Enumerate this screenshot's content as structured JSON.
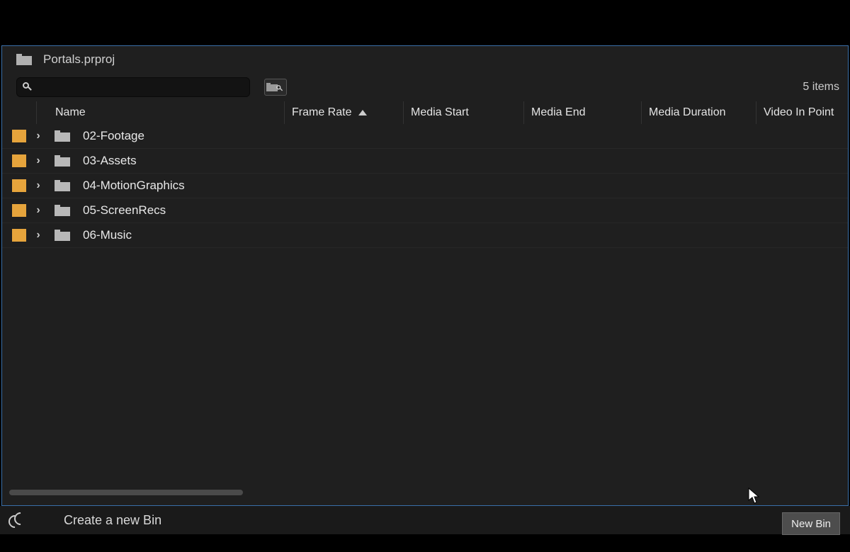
{
  "header": {
    "project_name": "Portals.prproj"
  },
  "search": {
    "placeholder": "",
    "item_count_label": "5 items"
  },
  "columns": {
    "name": "Name",
    "frame_rate": "Frame Rate",
    "media_start": "Media Start",
    "media_end": "Media End",
    "media_duration": "Media Duration",
    "video_in_point": "Video In Point"
  },
  "bins": [
    {
      "name": "02-Footage"
    },
    {
      "name": "03-Assets"
    },
    {
      "name": "04-MotionGraphics"
    },
    {
      "name": "05-ScreenRecs"
    },
    {
      "name": "06-Music"
    }
  ],
  "tutorial": {
    "hint": "Create a new Bin",
    "tooltip": "New Bin"
  }
}
